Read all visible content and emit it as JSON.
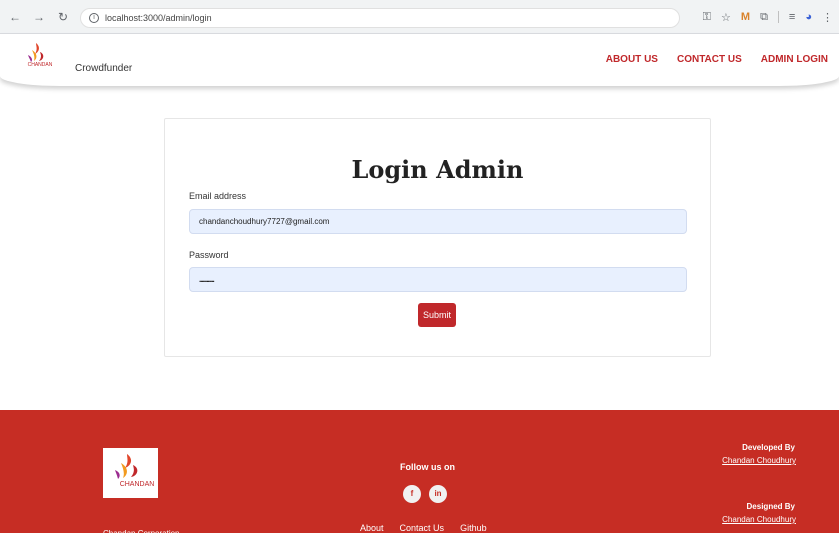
{
  "browser": {
    "url": "localhost:3000/admin/login"
  },
  "header": {
    "brand": "Crowdfunder",
    "nav": [
      "ABOUT US",
      "CONTACT US",
      "ADMIN LOGIN"
    ]
  },
  "login": {
    "title": "Login Admin",
    "email_label": "Email address",
    "email_value": "chandanchoudhury7727@gmail.com",
    "password_label": "Password",
    "password_value": "............",
    "submit_label": "Submit"
  },
  "footer": {
    "company": "Chandan Corporation",
    "follow_title": "Follow us on",
    "social": [
      "f",
      "in"
    ],
    "links": [
      "About",
      "Contact Us",
      "Github"
    ],
    "developed_by_label": "Developed By",
    "developed_by_name": "Chandan Choudhury",
    "designed_by_label": "Designed By",
    "designed_by_name": "Chandan Choudhury"
  },
  "colors": {
    "brand_red": "#c0282b",
    "footer_red": "#c62d24",
    "input_bg": "#e8f0fe"
  }
}
